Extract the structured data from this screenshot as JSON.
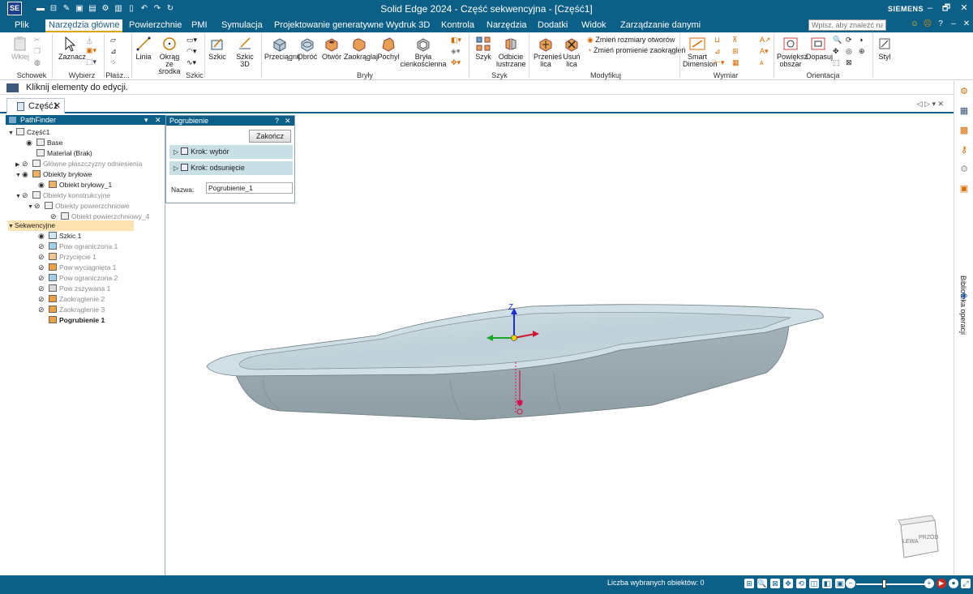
{
  "window": {
    "title": "Solid Edge 2024 - Część sekwencyjna - [Część1]",
    "brand": "SIEMENS",
    "app_logo": "SE",
    "controls": [
      "–",
      "🗗",
      "✕"
    ]
  },
  "quick_access": [
    "new-icon",
    "open-icon",
    "pin-icon",
    "save-icon",
    "print-icon",
    "gear-icon",
    "layout-icon",
    "undo-icon",
    "redo-icon"
  ],
  "tabs": [
    "Plik",
    "Narzędzia główne",
    "Powierzchnie",
    "PMI",
    "Symulacja",
    "Projektowanie generatywne",
    "Wydruk 3D",
    "Kontrola",
    "Narzędzia",
    "Dodatki",
    "Widok",
    "Zarządzanie danymi"
  ],
  "active_tab": "Narzędzia główne",
  "search": {
    "placeholder": "Wpisz, aby znaleźć na"
  },
  "ribbon": {
    "clipboard": {
      "paste": "Wklej",
      "group": "Schowek"
    },
    "select": {
      "select": "Zaznacz",
      "group": "Wybierz"
    },
    "plane": {
      "group": "Płasz..."
    },
    "sketch": {
      "line": "Linia",
      "circle": "Okrąg ze",
      "circle2": "środka",
      "group": "Szkic"
    },
    "sketch_btns": {
      "sketch": "Szkic",
      "sketch3d": "Szkic",
      "sketch3d2": "3D"
    },
    "solids": {
      "extrude": "Przeciągnij",
      "revolve": "Obróć",
      "hole": "Otwór",
      "round": "Zaokrąglaj",
      "draft": "Pochyl",
      "thin": "Bryła",
      "thin2": "cienkościenna",
      "group": "Bryły"
    },
    "pattern": {
      "pattern": "Szyk",
      "mirror": "Odbicie",
      "mirror2": "lustrzane",
      "group": "Szyk"
    },
    "modify": {
      "move": "Przenieś",
      "move2": "lica",
      "delete": "Usuń",
      "delete2": "lica",
      "resize_holes": "Zmień rozmiary otworów",
      "resize_rounds": "Zmień promienie zaokrągleń",
      "group": "Modyfikuj"
    },
    "dimension": {
      "smart": "Smart",
      "smart2": "Dimension",
      "group": "Wymiar"
    },
    "orient": {
      "zoom_area": "Powiększ",
      "zoom_area2": "obszar",
      "fit": "Dopasuj",
      "group": "Orientacja"
    },
    "style": {
      "label": "Styl"
    }
  },
  "prompt": "Kliknij elementy do edycji.",
  "document_tab": "Część1",
  "pathfinder": {
    "title": "PathFinder",
    "items": [
      {
        "label": "Część1",
        "level": 0
      },
      {
        "label": "Base",
        "level": 2
      },
      {
        "label": "Materiał (Brak)",
        "level": 2
      },
      {
        "label": "Główne płaszczyzny odniesienia",
        "level": 1
      },
      {
        "label": "Obiekty bryłowe",
        "level": 1
      },
      {
        "label": "Obiekt bryłowy_1",
        "level": 2
      },
      {
        "label": "Obiekty konstrukcyjne",
        "level": 1
      },
      {
        "label": "Obiekty powierzchniowe",
        "level": 2
      },
      {
        "label": "Obiekt powierzchniowy_4",
        "level": 3
      },
      {
        "label": "Sekwencyjne",
        "level": 0
      },
      {
        "label": "Szkic 1",
        "level": 2
      },
      {
        "label": "Pow ograniczona 1",
        "level": 2
      },
      {
        "label": "Przycięcie 1",
        "level": 2
      },
      {
        "label": "Pow wyciągnięta 1",
        "level": 2
      },
      {
        "label": "Pow ograniczona 2",
        "level": 2
      },
      {
        "label": "Pow zszywana 1",
        "level": 2
      },
      {
        "label": "Zaokrąglenie 2",
        "level": 2
      },
      {
        "label": "Zaokrąglenie 3",
        "level": 2
      },
      {
        "label": "Pogrubienie 1",
        "level": 2
      }
    ]
  },
  "thicken_panel": {
    "title": "Pogrubienie",
    "finish": "Zakończ",
    "step1": "Krok: wybór",
    "step2": "Krok: odsunięcie",
    "name_label": "Nazwa:",
    "name_value": "Pogrubienie_1"
  },
  "viewport": {
    "axis_z": "Z",
    "view_cube_left": "LEWA",
    "view_cube_front": "PRZÓD"
  },
  "right_dock": {
    "library": "Biblioteka operacji"
  },
  "status": {
    "selected": "Liczba wybranych obiektów: 0"
  },
  "colors": {
    "title_bar": "#0c5f86",
    "accent": "#d9a300",
    "part_surface": "#a9bcc3"
  }
}
